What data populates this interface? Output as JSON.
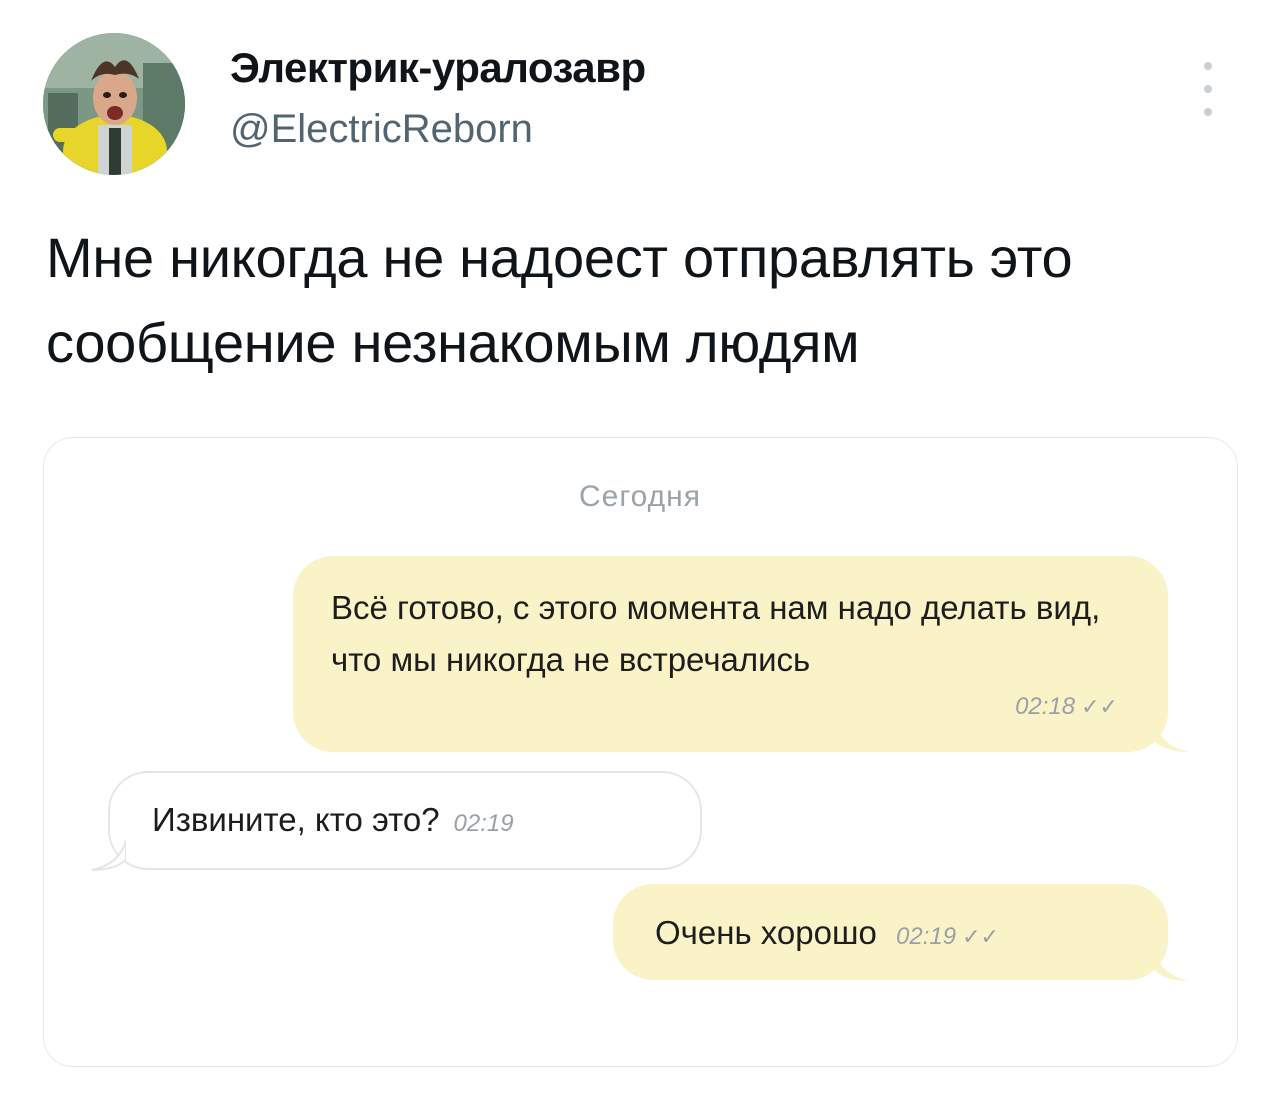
{
  "author": {
    "display_name": "Электрик-уралозавр",
    "handle": "@ElectricReborn",
    "avatar_icon": "profile-photo"
  },
  "tweet": {
    "text": "Мне никогда не надоест отправлять это сообщение незнакомым людям"
  },
  "chat": {
    "date_label": "Сегодня",
    "messages": [
      {
        "direction": "outgoing",
        "text": "Всё готово, с этого момента нам надо делать вид, что мы никогда не встречались",
        "time": "02:18",
        "status_icon": "double-check-icon",
        "ticks": "✓✓"
      },
      {
        "direction": "incoming",
        "text": "Извините, кто это?",
        "time": "02:19"
      },
      {
        "direction": "outgoing",
        "text": "Очень хорошо",
        "time": "02:19",
        "status_icon": "double-check-icon",
        "ticks": "✓✓"
      }
    ]
  },
  "colors": {
    "outgoing_bubble": "#faf3c7",
    "incoming_bubble": "#ffffff",
    "handle_gray": "#536471"
  }
}
